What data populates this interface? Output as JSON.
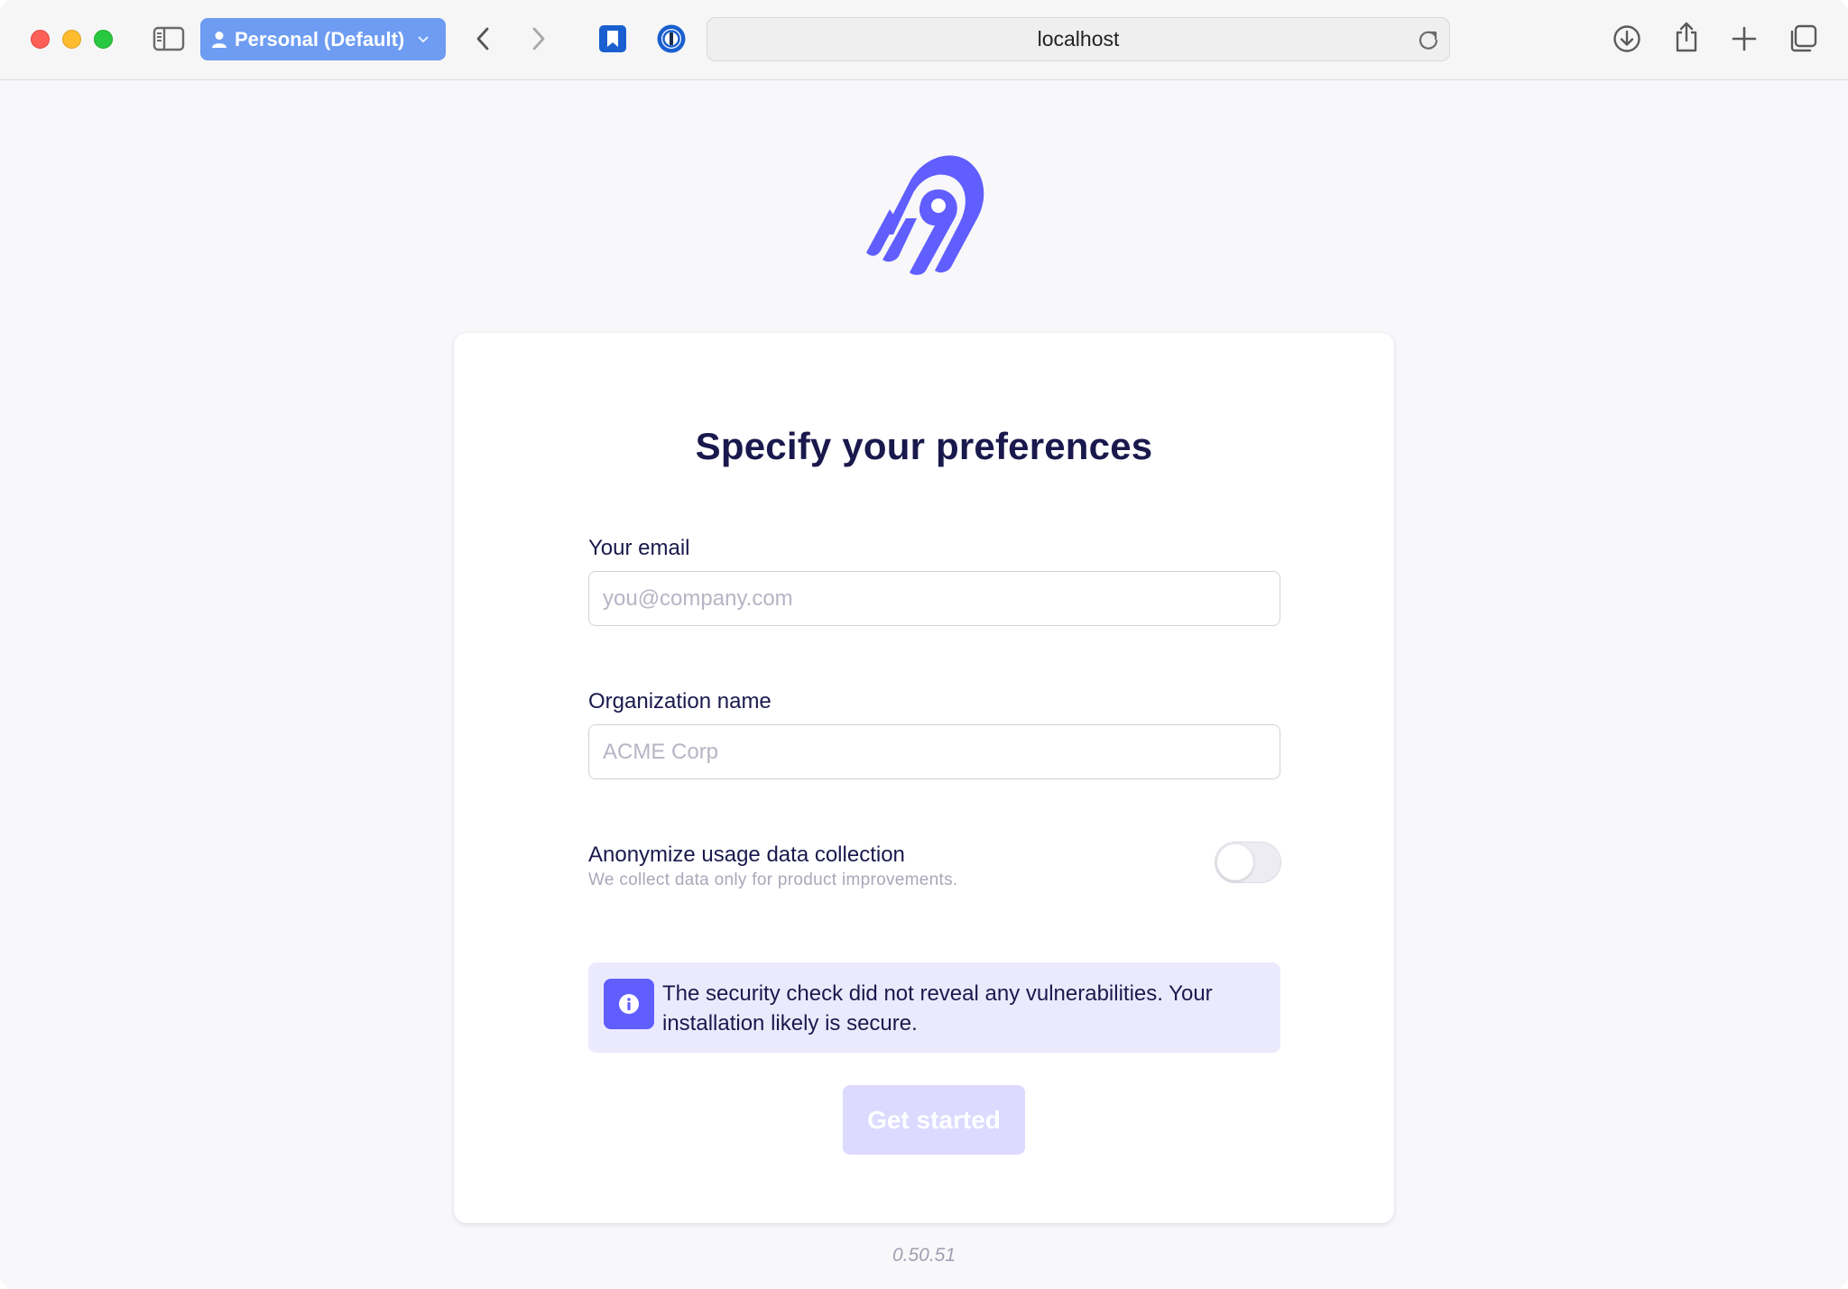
{
  "browser": {
    "profile_label": "Personal (Default)",
    "url": "localhost",
    "icons": {
      "sidebar": "sidebar-icon",
      "back": "chevron-left-icon",
      "forward": "chevron-right-icon",
      "bookmark_ext": "bookmark-extension-icon",
      "password_ext": "password-manager-icon",
      "reload": "reload-icon",
      "download": "download-icon",
      "share": "share-icon",
      "new_tab": "plus-icon",
      "tabs": "tab-overview-icon"
    }
  },
  "brand": {
    "accent": "#615eff",
    "text_dark": "#1a194d",
    "logo": "airbyte-logo"
  },
  "form": {
    "title": "Specify your preferences",
    "email": {
      "label": "Your email",
      "placeholder": "you@company.com",
      "value": ""
    },
    "organization": {
      "label": "Organization name",
      "placeholder": "ACME Corp",
      "value": ""
    },
    "anonymize": {
      "title": "Anonymize usage data collection",
      "subtitle": "We collect data only for product improvements.",
      "enabled": false
    },
    "notice": {
      "text": "The security check did not reveal any vulnerabilities. Your installation likely is secure.",
      "icon": "info-icon"
    },
    "submit_label": "Get started"
  },
  "footer": {
    "version": "0.50.51"
  }
}
